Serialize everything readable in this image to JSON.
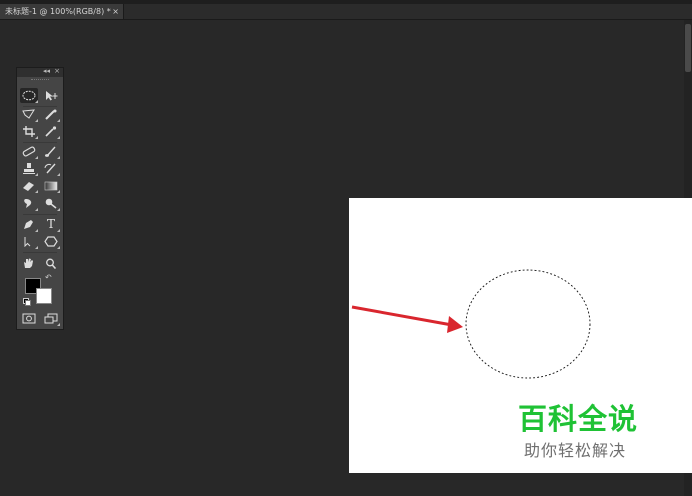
{
  "document": {
    "tab_title": "未标题-1 @ 100%(RGB/8) *",
    "tab_close": "×"
  },
  "toolbox": {
    "collapse_glyph": "◂◂",
    "close_glyph": "×",
    "tools": [
      {
        "name": "elliptical-marquee-tool",
        "icon": "ellipse-marquee-icon",
        "selected": true
      },
      {
        "name": "move-tool",
        "icon": "move-icon"
      },
      {
        "name": "polygonal-lasso-tool",
        "icon": "polygon-lasso-icon"
      },
      {
        "name": "quick-selection-tool",
        "icon": "quick-selection-icon"
      },
      {
        "name": "crop-tool",
        "icon": "crop-icon"
      },
      {
        "name": "eyedropper-tool",
        "icon": "eyedropper-icon"
      },
      {
        "name": "spot-healing-tool",
        "icon": "bandage-icon"
      },
      {
        "name": "brush-tool",
        "icon": "brush-icon"
      },
      {
        "name": "clone-stamp-tool",
        "icon": "stamp-icon"
      },
      {
        "name": "history-brush-tool",
        "icon": "history-brush-icon"
      },
      {
        "name": "eraser-tool",
        "icon": "eraser-icon"
      },
      {
        "name": "gradient-tool",
        "icon": "gradient-icon"
      },
      {
        "name": "blur-tool",
        "icon": "blur-drop-icon"
      },
      {
        "name": "dodge-tool",
        "icon": "dodge-icon"
      },
      {
        "name": "pen-tool",
        "icon": "pen-icon"
      },
      {
        "name": "type-tool",
        "icon": "type-icon",
        "glyph": "T"
      },
      {
        "name": "path-selection-tool",
        "icon": "path-selection-icon"
      },
      {
        "name": "shape-tool",
        "icon": "hexagon-icon"
      },
      {
        "name": "hand-tool",
        "icon": "hand-icon"
      },
      {
        "name": "zoom-tool",
        "icon": "zoom-icon"
      }
    ],
    "foreground_color": "#000000",
    "background_color": "#ffffff"
  },
  "watermark": {
    "title": "百科全说",
    "subtitle": "助你轻松解决",
    "title_color": "#1fc235"
  },
  "colors": {
    "workspace": "#282828",
    "panel": "#454545",
    "annotation_arrow": "#d9262e"
  }
}
